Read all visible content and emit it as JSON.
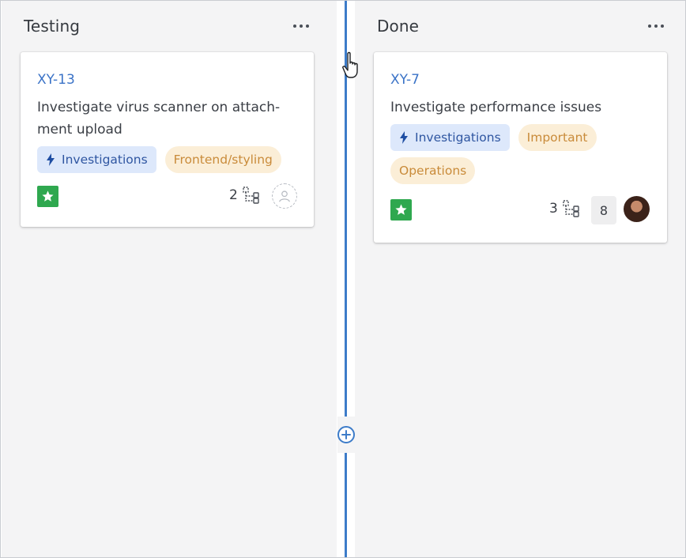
{
  "columns": [
    {
      "title": "Testing",
      "cards": [
        {
          "key": "XY-13",
          "title": "Investigate virus scanner on attach-ment upload",
          "tags": [
            {
              "label": "Investigations",
              "color": "blue",
              "icon": "bolt-icon"
            },
            {
              "label": "Frontend/styling",
              "color": "orange"
            }
          ],
          "issue_type_icon": "star-icon",
          "subtask_count": "2",
          "assignee": "unassigned-avatar-icon"
        }
      ]
    },
    {
      "title": "Done",
      "cards": [
        {
          "key": "XY-7",
          "title": "Investigate performance issues",
          "tags": [
            {
              "label": "Investigations",
              "color": "blue",
              "icon": "bolt-icon"
            },
            {
              "label": "Important",
              "color": "orange"
            },
            {
              "label": "Operations",
              "color": "orange"
            }
          ],
          "issue_type_icon": "star-icon",
          "subtask_count": "3",
          "comment_count": "8",
          "assignee": "user-avatar"
        }
      ]
    }
  ],
  "colors": {
    "link": "#3b73c7",
    "tag_blue_bg": "#dde8fb",
    "tag_orange_bg": "#fbeed7",
    "star_green": "#2fa84f",
    "divider_blue": "#3d7cc9",
    "column_bg": "#f4f4f5"
  }
}
